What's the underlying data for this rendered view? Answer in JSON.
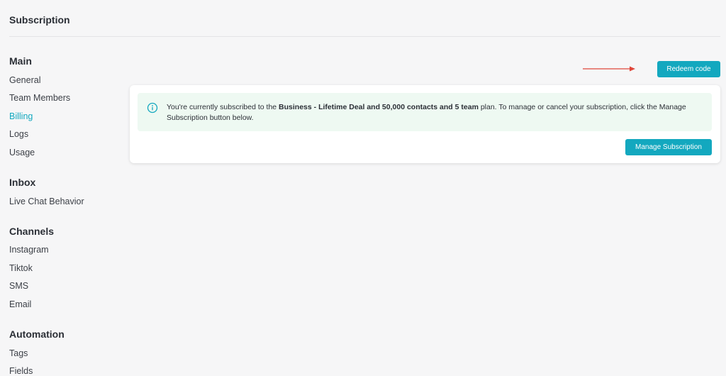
{
  "header": {
    "title": "Subscription"
  },
  "sidebar": {
    "sections": [
      {
        "title": "Main",
        "items": [
          "General",
          "Team Members",
          "Billing",
          "Logs",
          "Usage"
        ]
      },
      {
        "title": "Inbox",
        "items": [
          "Live Chat Behavior"
        ]
      },
      {
        "title": "Channels",
        "items": [
          "Instagram",
          "Tiktok",
          "SMS",
          "Email"
        ]
      },
      {
        "title": "Automation",
        "items": [
          "Tags",
          "Fields"
        ]
      }
    ],
    "active_item": "Billing"
  },
  "actions": {
    "redeem_label": "Redeem code"
  },
  "subscription": {
    "notice_prefix": "You're currently subscribed to the ",
    "plan_name": "Business - Lifetime Deal and 50,000 contacts and 5 team",
    "notice_suffix": " plan. To manage or cancel your subscription, click the Manage Subscription button below.",
    "manage_label": "Manage Subscription"
  },
  "colors": {
    "accent": "#13a8bf",
    "notice_bg": "#eef9f2",
    "arrow": "#e0463a"
  }
}
